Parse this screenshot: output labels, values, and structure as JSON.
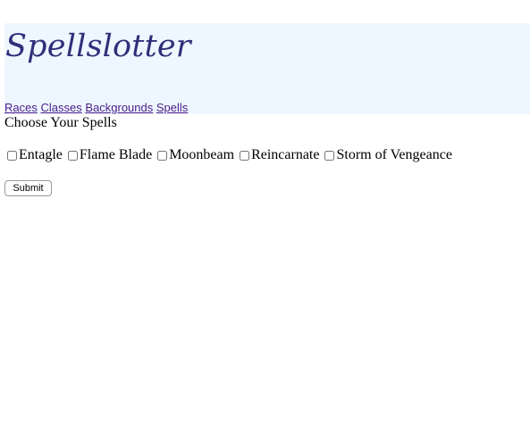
{
  "brand": {
    "logo_text": "Spellslotter",
    "logo_color": "#2f2f7a",
    "header_bg": "#eef7ff"
  },
  "nav": {
    "links": [
      "Races",
      "Classes",
      "Backgrounds",
      "Spells"
    ],
    "link_color": "#4b1d8a"
  },
  "main": {
    "heading": "Choose Your Spells",
    "spells": [
      {
        "label": "Entagle",
        "checked": false
      },
      {
        "label": "Flame Blade",
        "checked": false
      },
      {
        "label": "Moonbeam",
        "checked": false
      },
      {
        "label": "Reincarnate",
        "checked": false
      },
      {
        "label": "Storm of Vengeance",
        "checked": false
      }
    ],
    "submit_label": "Submit"
  }
}
